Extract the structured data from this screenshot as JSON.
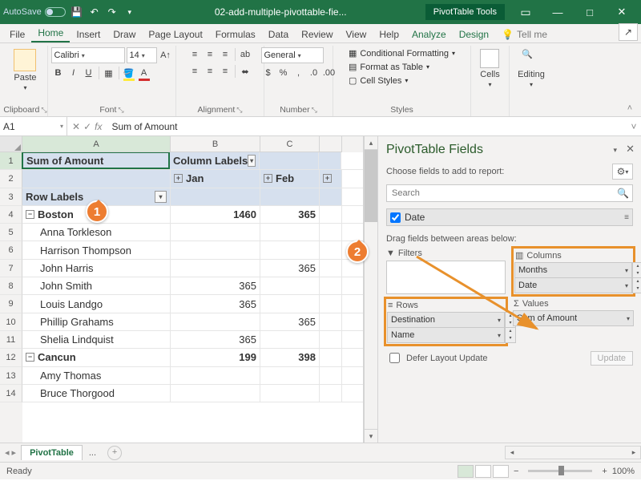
{
  "title": {
    "autosave": "AutoSave",
    "filename": "02-add-multiple-pivottable-fie...",
    "contextTool": "PivotTable Tools"
  },
  "tabs": {
    "file": "File",
    "home": "Home",
    "insert": "Insert",
    "draw": "Draw",
    "pageLayout": "Page Layout",
    "formulas": "Formulas",
    "data": "Data",
    "review": "Review",
    "view": "View",
    "help": "Help",
    "analyze": "Analyze",
    "design": "Design",
    "tell": "Tell me"
  },
  "ribbon": {
    "clipboard": {
      "label": "Clipboard",
      "paste": "Paste"
    },
    "font": {
      "label": "Font",
      "name": "Calibri",
      "size": "14",
      "bold": "B",
      "italic": "I",
      "underline": "U"
    },
    "alignment": {
      "label": "Alignment"
    },
    "number": {
      "label": "Number",
      "format": "General"
    },
    "styles": {
      "label": "Styles",
      "cond": "Conditional Formatting",
      "table": "Format as Table",
      "cell": "Cell Styles"
    },
    "cells": {
      "label": "Cells"
    },
    "editing": {
      "label": "Editing"
    }
  },
  "nameBox": "A1",
  "formula": "Sum of Amount",
  "cols": [
    "A",
    "B",
    "C"
  ],
  "grid": {
    "r1": {
      "a": "Sum of Amount",
      "b": "Column Labels"
    },
    "r2": {
      "b": "Jan",
      "c": "Feb"
    },
    "r3": {
      "a": "Row Labels"
    },
    "r4": {
      "a": "Boston",
      "b": "1460",
      "c": "365"
    },
    "r5": {
      "a": "Anna Torkleson"
    },
    "r6": {
      "a": "Harrison Thompson"
    },
    "r7": {
      "a": "John Harris",
      "c": "365"
    },
    "r8": {
      "a": "John Smith",
      "b": "365"
    },
    "r9": {
      "a": "Louis Landgo",
      "b": "365"
    },
    "r10": {
      "a": "Phillip Grahams",
      "c": "365"
    },
    "r11": {
      "a": "Shelia Lindquist",
      "b": "365"
    },
    "r12": {
      "a": "Cancun",
      "b": "199",
      "c": "398"
    },
    "r13": {
      "a": "Amy Thomas"
    },
    "r14": {
      "a": "Bruce Thorgood"
    }
  },
  "pane": {
    "title": "PivotTable Fields",
    "choose": "Choose fields to add to report:",
    "searchPH": "Search",
    "field1": "Date",
    "dragHint": "Drag fields between areas below:",
    "filters": "Filters",
    "columns": "Columns",
    "rows": "Rows",
    "values": "Values",
    "col1": "Months",
    "col2": "Date",
    "row1": "Destination",
    "row2": "Name",
    "val1": "Sum of Amount",
    "defer": "Defer Layout Update",
    "update": "Update"
  },
  "sheet": {
    "tab": "PivotTable",
    "more": "..."
  },
  "status": {
    "ready": "Ready",
    "zoom": "100%"
  },
  "callouts": {
    "one": "1",
    "two": "2"
  }
}
